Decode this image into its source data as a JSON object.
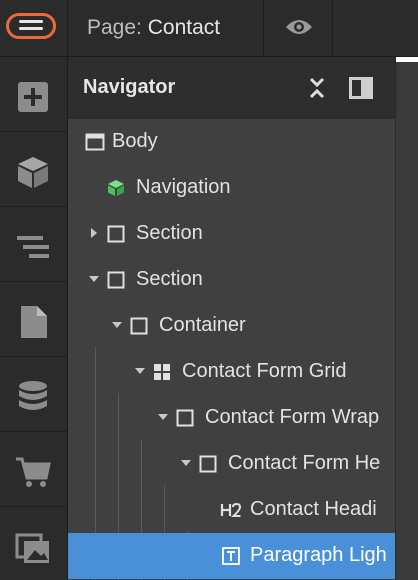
{
  "topbar": {
    "page_prefix": "Page:",
    "page_name": "Contact",
    "menu_icon": "hamburger-icon",
    "preview_icon": "eye-icon",
    "accent_color": "#e96b3b"
  },
  "rail": {
    "items": [
      {
        "icon": "add-icon"
      },
      {
        "icon": "cube-icon"
      },
      {
        "icon": "navigator-icon"
      },
      {
        "icon": "page-icon"
      },
      {
        "icon": "database-icon"
      },
      {
        "icon": "cart-icon"
      },
      {
        "icon": "assets-icon"
      }
    ]
  },
  "navigator": {
    "title": "Navigator",
    "collapse_icon": "collapse-icon",
    "dock_icon": "dock-panel-icon",
    "selection_color": "#4a90d9",
    "tree": [
      {
        "label": "Body",
        "icon": "body-icon",
        "caret": "none",
        "depth": 0
      },
      {
        "label": "Navigation",
        "icon": "symbol-icon",
        "caret": "none",
        "depth": 1
      },
      {
        "label": "Section",
        "icon": "box-icon",
        "caret": "collapsed",
        "depth": 0
      },
      {
        "label": "Section",
        "icon": "box-icon",
        "caret": "expanded",
        "depth": 0
      },
      {
        "label": "Container",
        "icon": "box-icon",
        "caret": "expanded",
        "depth": 1
      },
      {
        "label": "Contact Form Grid",
        "icon": "grid-icon",
        "caret": "expanded",
        "depth": 2
      },
      {
        "label": "Contact Form Wrap",
        "icon": "box-icon",
        "caret": "expanded",
        "depth": 3
      },
      {
        "label": "Contact Form He",
        "icon": "box-icon",
        "caret": "expanded",
        "depth": 4
      },
      {
        "label": "Contact Headi",
        "icon": "heading-h2-icon",
        "caret": "none",
        "depth": 5
      },
      {
        "label": "Paragraph Ligh",
        "icon": "text-block-icon",
        "caret": "none",
        "depth": 5,
        "selected": true
      }
    ]
  }
}
